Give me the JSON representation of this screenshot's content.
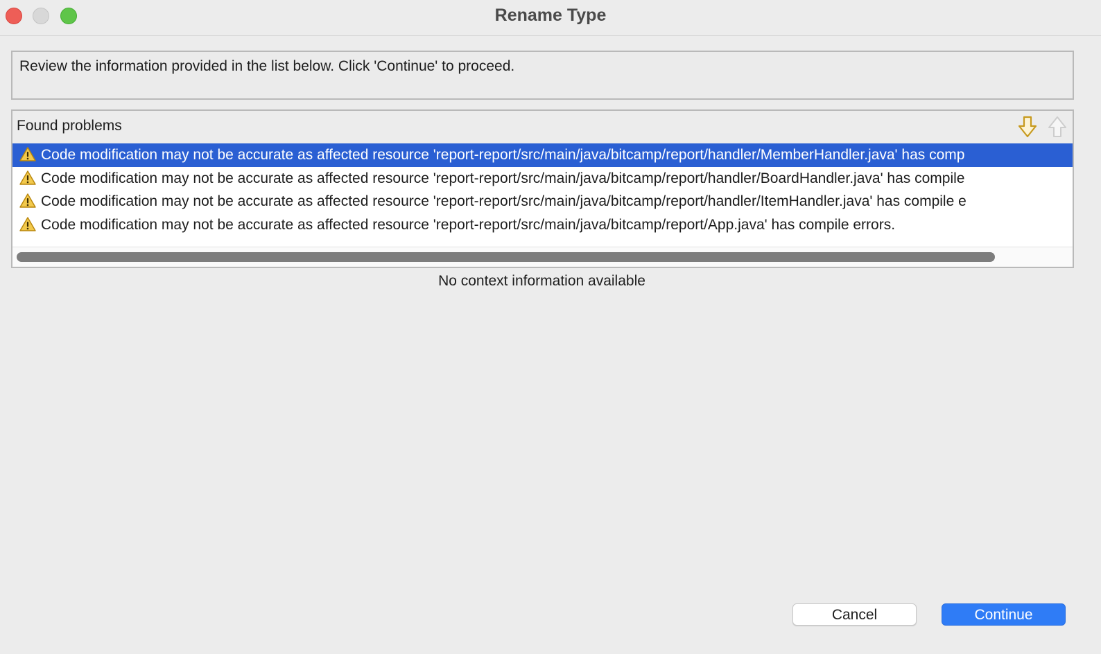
{
  "window": {
    "title": "Rename Type"
  },
  "message": "Review the information provided in the list below. Click 'Continue' to proceed.",
  "problems": {
    "title": "Found problems",
    "next_icon": "arrow-down-icon",
    "prev_icon": "arrow-up-icon",
    "items": [
      {
        "icon": "warning-icon",
        "text": "Code modification may not be accurate as affected resource 'report-report/src/main/java/bitcamp/report/handler/MemberHandler.java' has comp",
        "selected": true
      },
      {
        "icon": "warning-icon",
        "text": "Code modification may not be accurate as affected resource 'report-report/src/main/java/bitcamp/report/handler/BoardHandler.java' has compile",
        "selected": false
      },
      {
        "icon": "warning-icon",
        "text": "Code modification may not be accurate as affected resource 'report-report/src/main/java/bitcamp/report/handler/ItemHandler.java' has compile e",
        "selected": false
      },
      {
        "icon": "warning-icon",
        "text": "Code modification may not be accurate as affected resource 'report-report/src/main/java/bitcamp/report/App.java' has compile errors.",
        "selected": false
      }
    ]
  },
  "context_info": "No context information available",
  "buttons": {
    "cancel": "Cancel",
    "continue": "Continue"
  },
  "colors": {
    "accent": "#2f7cf6",
    "selection": "#2a5fd3",
    "warning": "#f2c94c"
  }
}
